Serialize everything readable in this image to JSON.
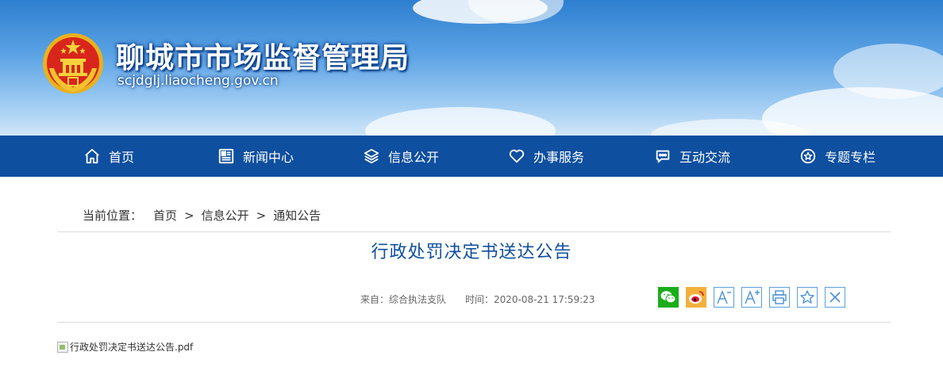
{
  "header": {
    "title": "聊城市市场监督管理局",
    "domain": "scjdglj.liaocheng.gov.cn",
    "emblem_icon": "national-emblem"
  },
  "nav": {
    "items": [
      {
        "label": "首页",
        "icon": "home-icon"
      },
      {
        "label": "新闻中心",
        "icon": "newspaper-icon"
      },
      {
        "label": "信息公开",
        "icon": "layers-icon"
      },
      {
        "label": "办事服务",
        "icon": "heart-icon"
      },
      {
        "label": "互动交流",
        "icon": "chat-icon"
      },
      {
        "label": "专题专栏",
        "icon": "star-circle-icon"
      }
    ],
    "background": "#0f4f9f"
  },
  "breadcrumb": {
    "label": "当前位置：",
    "items": [
      "首页",
      "信息公开",
      "通知公告"
    ],
    "separator": ">"
  },
  "article": {
    "title": "行政处罚决定书送达公告",
    "source": "来自：综合执法支队",
    "time": "时间：2020-08-21 17:59:23",
    "attachment": "行政处罚决定书送达公告.pdf"
  },
  "tools": [
    "wechat-share-icon",
    "weibo-share-icon",
    "font-decrease-icon",
    "font-increase-icon",
    "print-icon",
    "favorite-icon",
    "close-icon"
  ],
  "colors": {
    "accent": "#0f4f9f",
    "title": "#0f4f9f",
    "wechat": "#1aad19",
    "weibo": "#e6162d"
  }
}
